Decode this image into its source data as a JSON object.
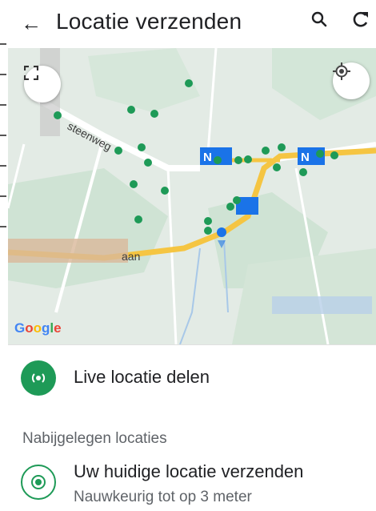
{
  "appbar": {
    "title": "Locatie verzenden",
    "back_icon": "←",
    "search_icon": "⚲",
    "refresh_icon": "C"
  },
  "map": {
    "road_label_1": "steenweg",
    "road_label_2": "aan",
    "google_letters": [
      "G",
      "o",
      "o",
      "g",
      "l",
      "e"
    ],
    "colors": {
      "map_bg": "#dfe9e2",
      "road": "#f5c542",
      "marker": "#1e9a57",
      "station": "#1a73e8"
    }
  },
  "live": {
    "label": "Live locatie delen"
  },
  "nearby": {
    "heading": "Nabijgelegen locaties"
  },
  "current": {
    "title": "Uw huidige locatie verzenden",
    "subtitle": "Nauwkeurig tot op 3 meter"
  }
}
